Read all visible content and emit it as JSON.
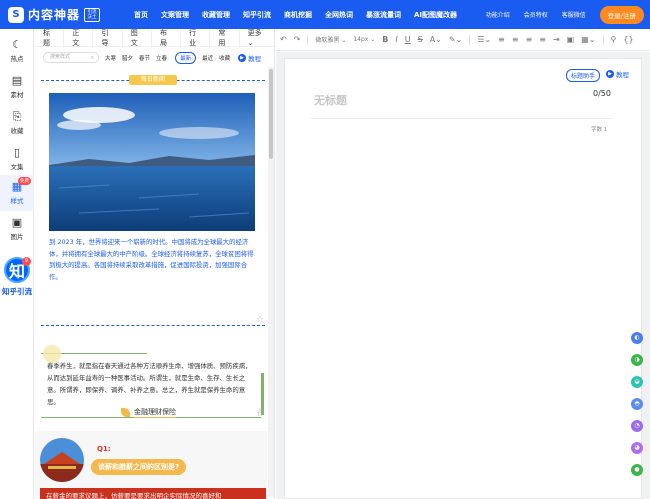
{
  "nav": {
    "logo_text": "内容神器",
    "logo_badge": "引流 沃土",
    "links": [
      "首页",
      "文案管理",
      "收藏管理",
      "知乎引流",
      "商机挖掘",
      "全网热词",
      "暴涨流量词",
      "AI配图魔改器"
    ],
    "right_links": [
      "功能介绍",
      "会员特权",
      "客服微信"
    ],
    "login": "登录/注册"
  },
  "sidebar": {
    "items": [
      {
        "icon": "hot-icon",
        "label": "热点"
      },
      {
        "icon": "material-icon",
        "label": "素材"
      },
      {
        "icon": "collect-icon",
        "label": "收藏"
      },
      {
        "icon": "document-icon",
        "label": "文集"
      },
      {
        "icon": "style-icon",
        "label": "样式",
        "badge": "免费",
        "active": true
      },
      {
        "icon": "image-icon",
        "label": "图片"
      }
    ],
    "zhihu": {
      "logo": "知",
      "dot": "9",
      "label": "知乎引流"
    }
  },
  "panel": {
    "tabs": [
      "标题",
      "正文",
      "引导",
      "图文",
      "布局",
      "行业",
      "常用",
      "更多 ⌄"
    ],
    "search_placeholder": "搜索样式",
    "filters": [
      "大寒",
      "腊夕",
      "春节",
      "立春"
    ],
    "filters_right": [
      "最新",
      "最近",
      "收藏"
    ],
    "tutorial": "教程",
    "card1_tag": "每日新闻",
    "card1_text": "到 2023 年，世界将迎来一个崭新的时代。中国将成为全球最大的经济体，并将拥有全球最大的中产阶级。全球经济将持续复苏，全球贫困将得到极大的提高。各国将持续采取改革措施，促进国际投资，加强国际合作。",
    "card2_text": "春季养生，就是指在春天通过各种方法顺养生命、增强体质、预防疾病，从而达到延年益寿的一种医事活动。所谓生，就是生命、生存、生长之意。所谓养，即保养、调养、补养之意。总之，养生就是保养生命的意思。",
    "card3_title": "金融理财保险",
    "card4_q": "Q1:",
    "card4_question": "谈薪和腊薪之间的区别是?",
    "card4_red": "在薪金的要求议题上，仿薪要是要求出明企实际情况的喜好和"
  },
  "editor": {
    "toolbar_font": "微软雅黑 ⌄",
    "toolbar_size": "14px ⌄",
    "assistant": "标题助手",
    "tutorial": "教程",
    "doc_title": "无标题",
    "title_count": "0/50",
    "word_count": "字数 1"
  },
  "colors": {
    "brand": "#1a5bf0",
    "accent": "#ff8a1f"
  }
}
